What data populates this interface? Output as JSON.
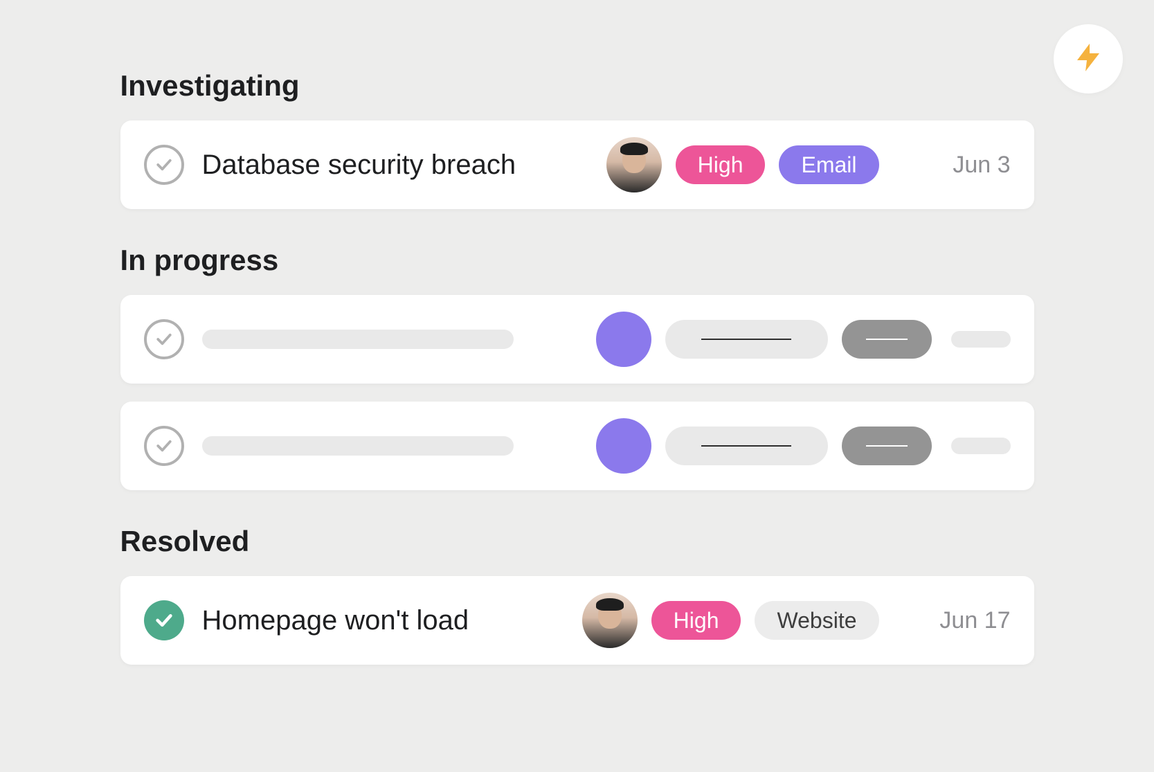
{
  "actions": {
    "rules_button_icon": "lightning-icon"
  },
  "sections": [
    {
      "heading": "Investigating",
      "tasks": [
        {
          "completed": false,
          "title": "Database security breach",
          "assignee": "user-avatar",
          "priority": {
            "label": "High",
            "bg": "#ed5598",
            "fg": "#ffffff"
          },
          "category": {
            "label": "Email",
            "bg": "#8b79ec",
            "fg": "#ffffff"
          },
          "date": "Jun 3"
        }
      ]
    },
    {
      "heading": "In progress",
      "tasks": [
        {
          "placeholder": true,
          "avatar_color": "#8b79ec"
        },
        {
          "placeholder": true,
          "avatar_color": "#8b79ec"
        }
      ]
    },
    {
      "heading": "Resolved",
      "tasks": [
        {
          "completed": true,
          "title": "Homepage won't load",
          "assignee": "user-avatar",
          "priority": {
            "label": "High",
            "bg": "#ed5598",
            "fg": "#ffffff"
          },
          "category": {
            "label": "Website",
            "bg": "#ececec",
            "fg": "#3e3e3e"
          },
          "date": "Jun 17"
        }
      ]
    }
  ]
}
